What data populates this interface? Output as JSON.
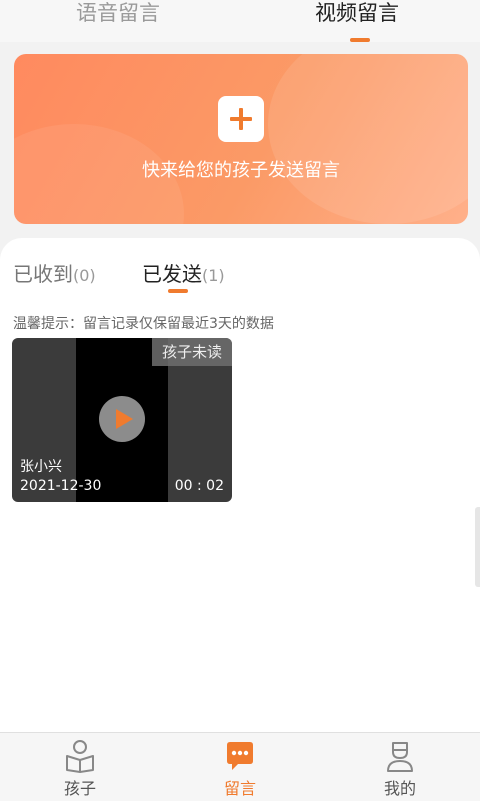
{
  "top_tabs": {
    "voice": "语音留言",
    "video": "视频留言"
  },
  "banner": {
    "text": "快来给您的孩子发送留言"
  },
  "sub_tabs": {
    "received_label": "已收到",
    "received_count": "(0)",
    "sent_label": "已发送",
    "sent_count": "(1)"
  },
  "tip": "温馨提示：留言记录仅保留最近3天的数据",
  "videos": [
    {
      "status": "孩子未读",
      "name": "张小兴",
      "date": "2021-12-30",
      "duration": "00 : 02"
    }
  ],
  "bottom_nav": {
    "child": "孩子",
    "message": "留言",
    "mine": "我的"
  },
  "colors": {
    "accent": "#f07b2e",
    "banner_start": "#ff8a5f",
    "banner_end": "#ffb08a"
  }
}
